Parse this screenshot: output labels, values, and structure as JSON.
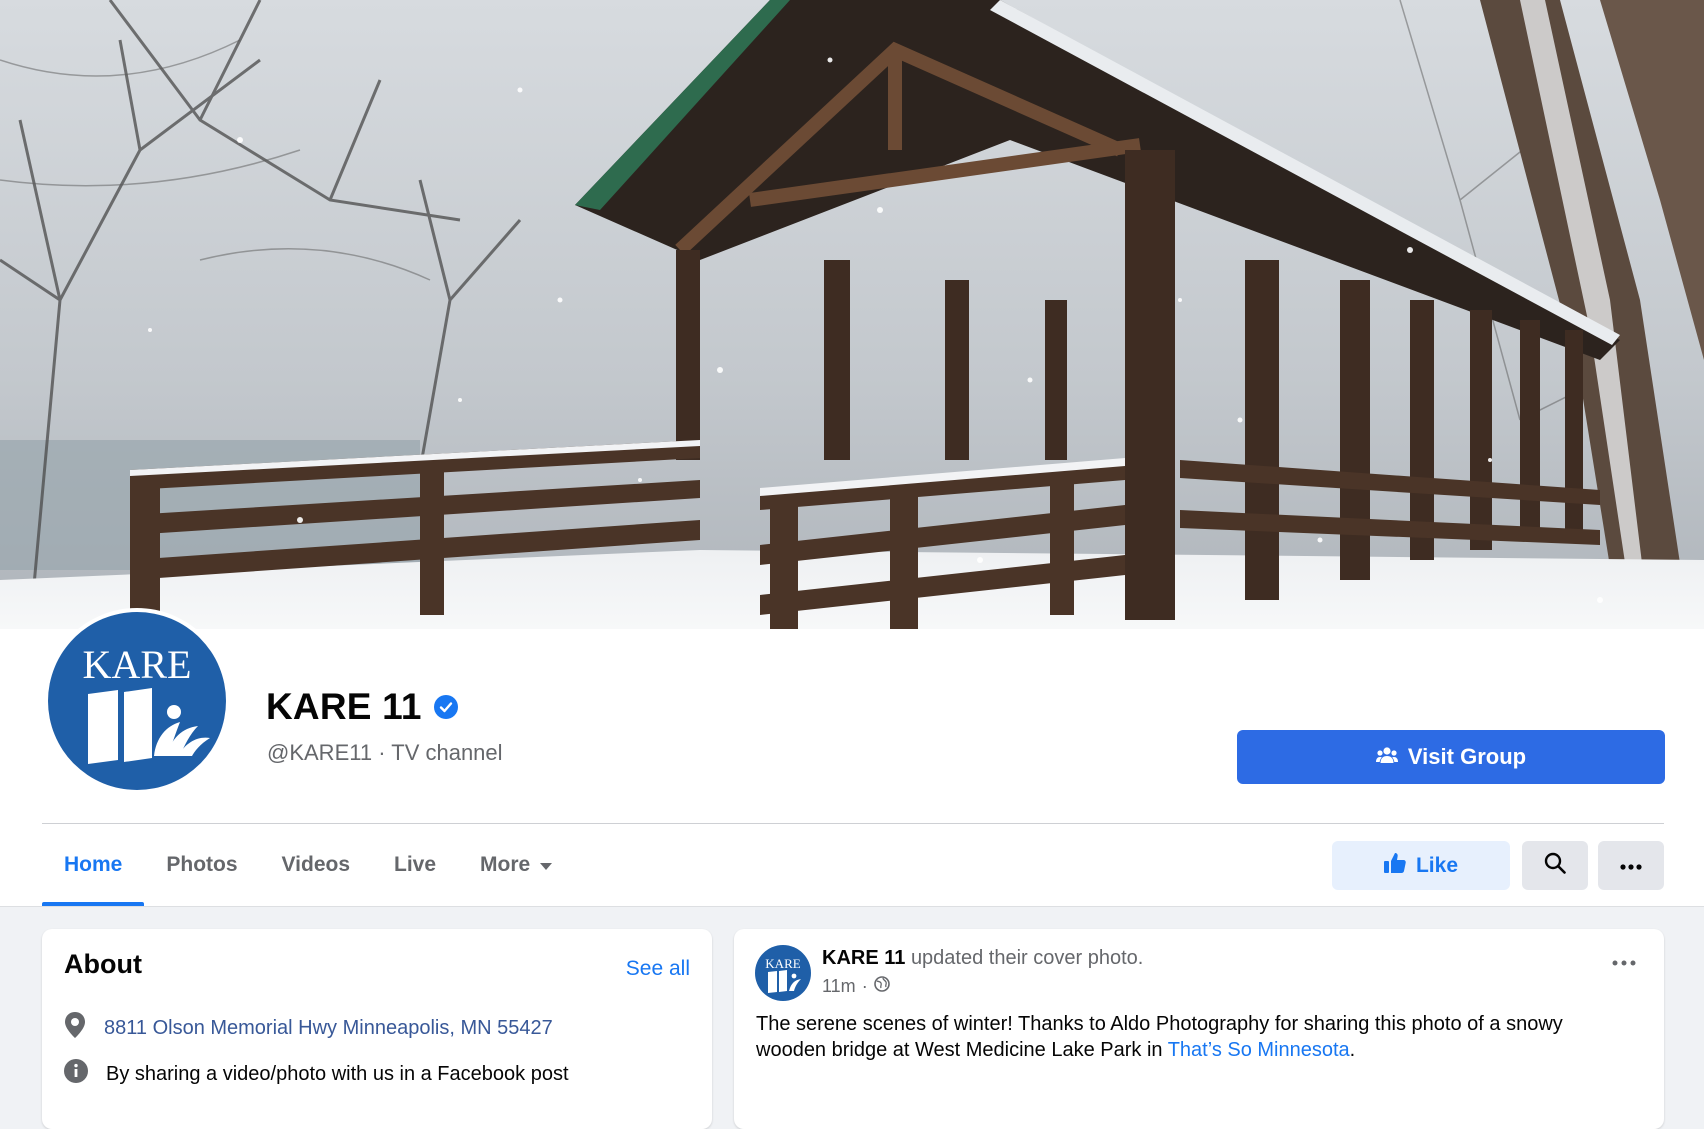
{
  "cover": {
    "alt_icon": "cover-photo-snowy-bridge"
  },
  "profile": {
    "logo_text": "KARE",
    "logo_number": "11",
    "name": "KARE 11",
    "handle": "@KARE11",
    "category": "TV channel",
    "separator": " · "
  },
  "actions": {
    "visit_group": "Visit Group",
    "like": "Like"
  },
  "tabs": [
    {
      "label": "Home",
      "active": true
    },
    {
      "label": "Photos"
    },
    {
      "label": "Videos"
    },
    {
      "label": "Live"
    },
    {
      "label": "More"
    }
  ],
  "about": {
    "title": "About",
    "see_all": "See all",
    "address": "8811 Olson Memorial Hwy Minneapolis, MN 55427",
    "info": "By sharing a video/photo with us in a Facebook post"
  },
  "post": {
    "author": "KARE 11",
    "action": "updated their cover photo.",
    "time": "11m",
    "dot": "·",
    "text_before": "The serene scenes of winter! Thanks to Aldo Photography for sharing this photo of a snowy wooden bridge at West Medicine Lake Park in ",
    "text_link": "That’s So Minnesota",
    "text_after": "."
  },
  "colors": {
    "accent": "#1877f2",
    "brand_blue": "#1f5fa8",
    "visit_button": "#2d6be4"
  }
}
